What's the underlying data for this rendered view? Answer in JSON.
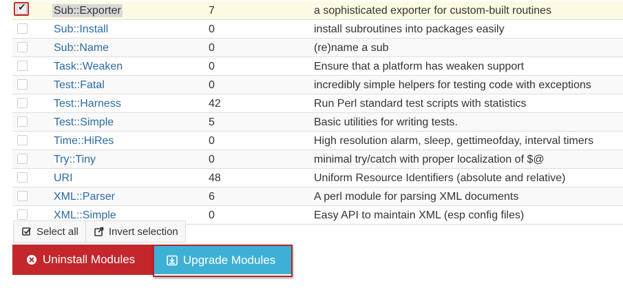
{
  "modules": [
    {
      "name": "Sub::Exporter",
      "count": "7",
      "description": "a sophisticated exporter for custom-built routines",
      "checked": true,
      "highlighted": true
    },
    {
      "name": "Sub::Install",
      "count": "0",
      "description": "install subroutines into packages easily",
      "checked": false
    },
    {
      "name": "Sub::Name",
      "count": "0",
      "description": "(re)name a sub",
      "checked": false
    },
    {
      "name": "Task::Weaken",
      "count": "0",
      "description": "Ensure that a platform has weaken support",
      "checked": false
    },
    {
      "name": "Test::Fatal",
      "count": "0",
      "description": "incredibly simple helpers for testing code with exceptions",
      "checked": false
    },
    {
      "name": "Test::Harness",
      "count": "42",
      "description": "Run Perl standard test scripts with statistics",
      "checked": false
    },
    {
      "name": "Test::Simple",
      "count": "5",
      "description": "Basic utilities for writing tests.",
      "checked": false
    },
    {
      "name": "Time::HiRes",
      "count": "0",
      "description": "High resolution alarm, sleep, gettimeofday, interval timers",
      "checked": false
    },
    {
      "name": "Try::Tiny",
      "count": "0",
      "description": "minimal try/catch with proper localization of $@",
      "checked": false
    },
    {
      "name": "URI",
      "count": "48",
      "description": "Uniform Resource Identifiers (absolute and relative)",
      "checked": false
    },
    {
      "name": "XML::Parser",
      "count": "6",
      "description": "A perl module for parsing XML documents",
      "checked": false
    },
    {
      "name": "XML::Simple",
      "count": "0",
      "description": "Easy API to maintain XML (esp config files)",
      "checked": false
    }
  ],
  "selection": {
    "select_all_label": "Select all",
    "invert_label": "Invert selection",
    "select_all_icon": "checkbox-icon",
    "invert_icon": "external-link-icon"
  },
  "actions": {
    "uninstall_label": "Uninstall Modules",
    "upgrade_label": "Upgrade Modules",
    "uninstall_icon": "circle-x-icon",
    "upgrade_icon": "download-box-icon"
  },
  "colors": {
    "link": "#2b6aa3",
    "danger": "#c3262b",
    "info": "#3eb0d5",
    "selected_row": "#fcfae2",
    "highlight_frame": "#b3262b"
  }
}
